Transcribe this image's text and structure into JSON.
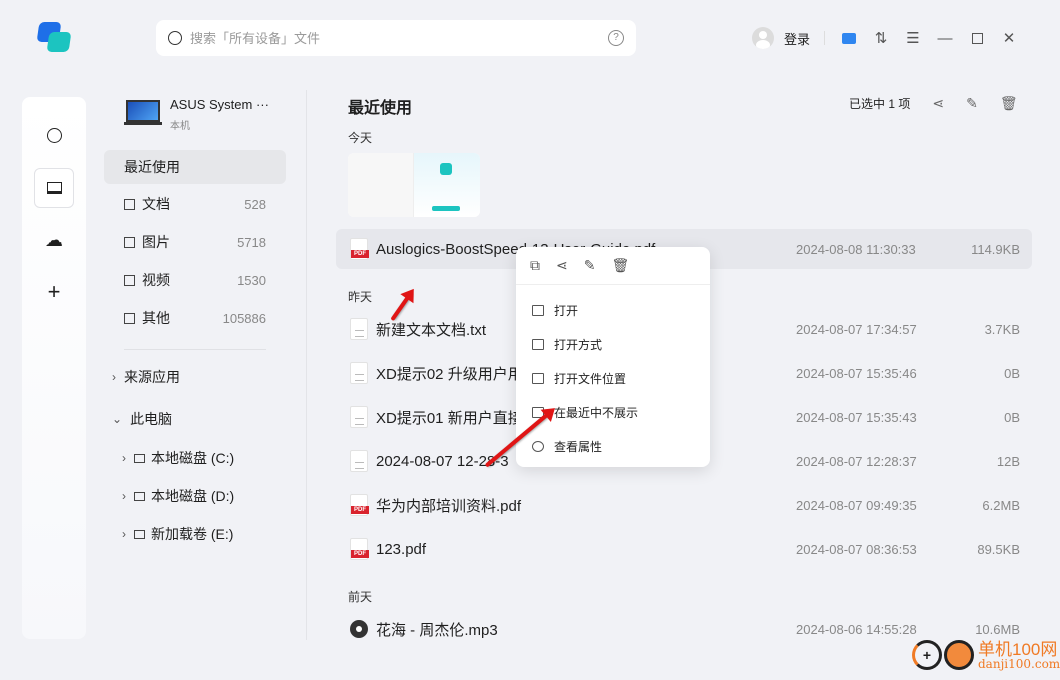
{
  "search": {
    "placeholder": "搜索「所有设备」文件"
  },
  "topbar": {
    "login": "登录"
  },
  "device": {
    "name": "ASUS System ···",
    "sub": "本机"
  },
  "nav": {
    "recent": "最近使用",
    "items": [
      {
        "label": "文档",
        "count": "528"
      },
      {
        "label": "图片",
        "count": "5718"
      },
      {
        "label": "视频",
        "count": "1530"
      },
      {
        "label": "其他",
        "count": "105886"
      }
    ]
  },
  "tree": {
    "source_apps": "来源应用",
    "this_pc": "此电脑",
    "drives": [
      "本地磁盘 (C:)",
      "本地磁盘 (D:)",
      "新加载卷 (E:)"
    ]
  },
  "main": {
    "title": "最近使用",
    "selected": "已选中 1 项"
  },
  "sections": {
    "today": "今天",
    "yesterday": "昨天",
    "day_before": "前天"
  },
  "files": [
    {
      "name": "Auslogics-BoostSpeed-13-User-Guide.pdf",
      "date": "2024-08-08 11:30:33",
      "size": "114.9KB",
      "type": "pdf"
    },
    {
      "name": "新建文本文档.txt",
      "date": "2024-08-07 17:34:57",
      "size": "3.7KB",
      "type": "txt"
    },
    {
      "name": "XD提示02 升级用户用                         .txt",
      "date": "2024-08-07 15:35:46",
      "size": "0B",
      "type": "txt"
    },
    {
      "name": "XD提示01 新用户直接",
      "date": "2024-08-07 15:35:43",
      "size": "0B",
      "type": "txt"
    },
    {
      "name": "2024-08-07 12-28-3",
      "date": "2024-08-07 12:28:37",
      "size": "12B",
      "type": "txt"
    },
    {
      "name": "华为内部培训资料.pdf",
      "date": "2024-08-07 09:49:35",
      "size": "6.2MB",
      "type": "pdf"
    },
    {
      "name": "123.pdf",
      "date": "2024-08-07 08:36:53",
      "size": "89.5KB",
      "type": "pdf"
    },
    {
      "name": "花海 - 周杰伦.mp3",
      "date": "2024-08-06 14:55:28",
      "size": "10.6MB",
      "type": "mp3"
    }
  ],
  "context_menu": {
    "items": [
      "打开",
      "打开方式",
      "打开文件位置",
      "在最近中不展示",
      "查看属性"
    ]
  },
  "watermark": {
    "cn": "单机100网",
    "en": "danji100.com"
  },
  "colors": {
    "accent": "#1e6fe8",
    "pdf": "#d9232d",
    "arrow": "#e01515"
  }
}
